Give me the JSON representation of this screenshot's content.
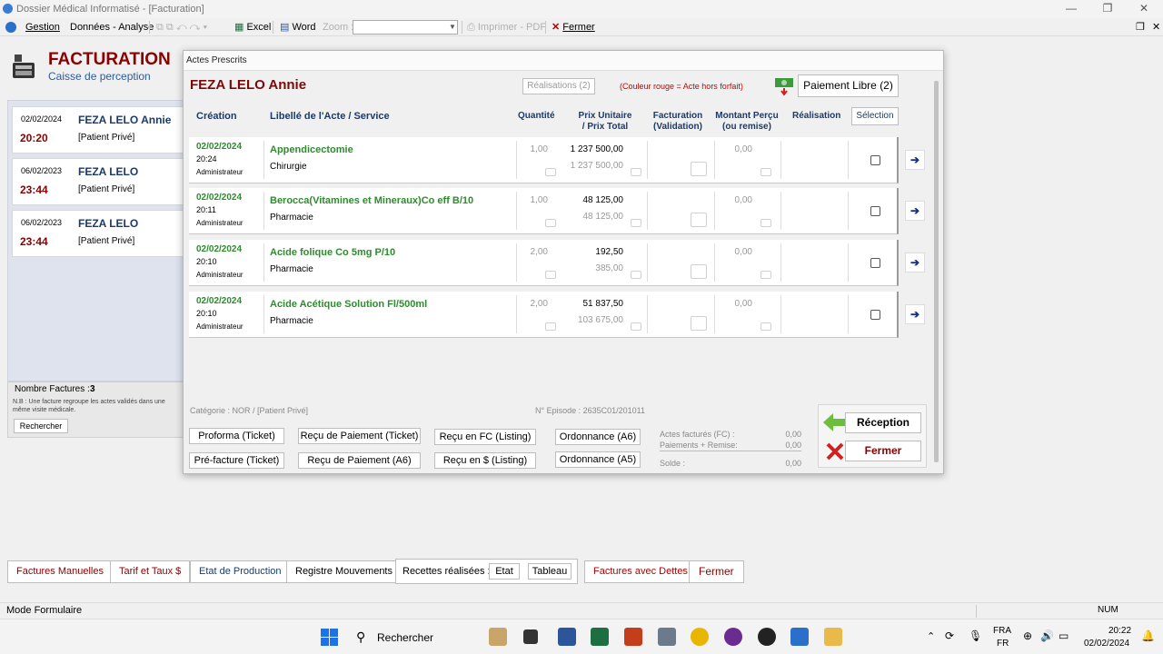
{
  "window": {
    "title": "Dossier Médical Informatisé - [Facturation]"
  },
  "menubar": {
    "gestion": "Gestion",
    "donnees": "Données - Analyse",
    "excel": "Excel",
    "word": "Word",
    "zoom_label": "Zoom :",
    "imprimer": "Imprimer - PDF",
    "fermer": "Fermer"
  },
  "header": {
    "title": "FACTURATION",
    "subtitle": "Caisse de perception"
  },
  "invoices": [
    {
      "date": "02/02/2024",
      "name": "FEZA LELO Annie",
      "time": "20:20",
      "category": "[Patient Privé]"
    },
    {
      "date": "06/02/2023",
      "name": "FEZA LELO",
      "time": "23:44",
      "category": "[Patient Privé]"
    },
    {
      "date": "06/02/2023",
      "name": "FEZA LELO",
      "time": "23:44",
      "category": "[Patient Privé]"
    }
  ],
  "left_footer": {
    "nb_label": "Nombre Factures :",
    "nb_value": "3",
    "note": "N.B : Une facture regroupe les actes validés dans une même visite médicale.",
    "search": "Rechercher"
  },
  "modal": {
    "title": "Actes Prescrits",
    "patient": "FEZA LELO Annie",
    "realisations": "Réalisations (2)",
    "couleur_note": "(Couleur rouge = Acte hors forfait)",
    "paiement_libre": "Paiement Libre (2)",
    "columns": {
      "creation": "Création",
      "libelle": "Libellé de l'Acte / Service",
      "quantite": "Quantité",
      "prix1": "Prix Unitaire",
      "prix2": "/ Prix Total",
      "fact1": "Facturation",
      "fact2": "(Validation)",
      "mont1": "Montant Perçu",
      "mont2": "(ou remise)",
      "realisation": "Réalisation",
      "selection": "Sélection"
    },
    "rows": [
      {
        "date": "02/02/2024",
        "time": "20:24",
        "user": "Administrateur",
        "label": "Appendicectomie",
        "service": "Chirurgie",
        "qty": "1,00",
        "unit": "1 237 500,00",
        "total": "1 237 500,00",
        "percu": "0,00"
      },
      {
        "date": "02/02/2024",
        "time": "20:11",
        "user": "Administrateur",
        "label": "Berocca(Vitamines et Mineraux)Co eff B/10",
        "service": "Pharmacie",
        "qty": "1,00",
        "unit": "48 125,00",
        "total": "48 125,00",
        "percu": "0,00"
      },
      {
        "date": "02/02/2024",
        "time": "20:10",
        "user": "Administrateur",
        "label": "Acide folique Co 5mg P/10",
        "service": "Pharmacie",
        "qty": "2,00",
        "unit": "192,50",
        "total": "385,00",
        "percu": "0,00"
      },
      {
        "date": "02/02/2024",
        "time": "20:10",
        "user": "Administrateur",
        "label": "Acide Acétique Solution Fl/500ml",
        "service": "Pharmacie",
        "qty": "2,00",
        "unit": "51 837,50",
        "total": "103 675,00",
        "percu": "0,00"
      }
    ],
    "categorie": "Catégorie : NOR / [Patient Privé]",
    "episode": "N° Episode : 2635C01/201011",
    "buttons": {
      "proforma": "Proforma (Ticket)",
      "recu_paiement_ticket": "Reçu de Paiement (Ticket)",
      "recu_fc": "Reçu en FC (Listing)",
      "ordonnance_a6": "Ordonnance (A6)",
      "prefacture": "Pré-facture (Ticket)",
      "recu_paiement_a6": "Reçu de Paiement (A6)",
      "recu_usd": "Reçu en $ (Listing)",
      "ordonnance_a5": "Ordonnance (A5)",
      "reception": "Réception",
      "fermer": "Fermer"
    },
    "totals": {
      "actes_label": "Actes facturés (FC) :",
      "actes_value": "0,00",
      "paiements_label": "Paiements + Remise:",
      "paiements_value": "0,00",
      "solde_label": "Solde :",
      "solde_value": "0,00"
    }
  },
  "bottom": {
    "factures_manuelles": "Factures Manuelles",
    "tarif": "Tarif et Taux $",
    "etat_production": "Etat de Production",
    "registre": "Registre Mouvements",
    "recettes_label": "Recettes réalisées :",
    "etat": "Etat",
    "tableau": "Tableau",
    "factures_dettes": "Factures avec Dettes",
    "fermer": "Fermer"
  },
  "status": {
    "mode": "Mode Formulaire",
    "num": "NUM"
  },
  "taskbar": {
    "search": "Rechercher",
    "lang1": "FRA",
    "lang2": "FR",
    "time": "20:22",
    "date": "02/02/2024"
  },
  "colors": {
    "accent_red": "#8b0000",
    "green": "#2e8b2e",
    "navy": "#1b3a6b"
  }
}
